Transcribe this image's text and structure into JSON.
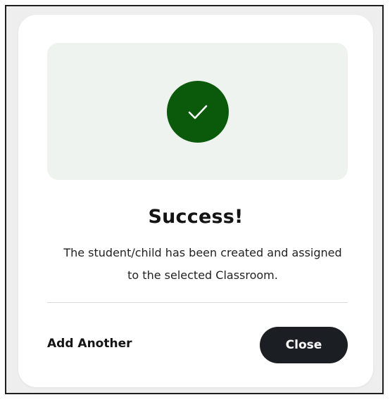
{
  "dialog": {
    "title": "Success!",
    "message": "The student/child has been created and assigned to the selected Classroom.",
    "icon": "check-icon",
    "icon_color": "#0b5a0b",
    "hero_background": "#eef3ef"
  },
  "actions": {
    "add_another_label": "Add Another",
    "close_label": "Close"
  }
}
